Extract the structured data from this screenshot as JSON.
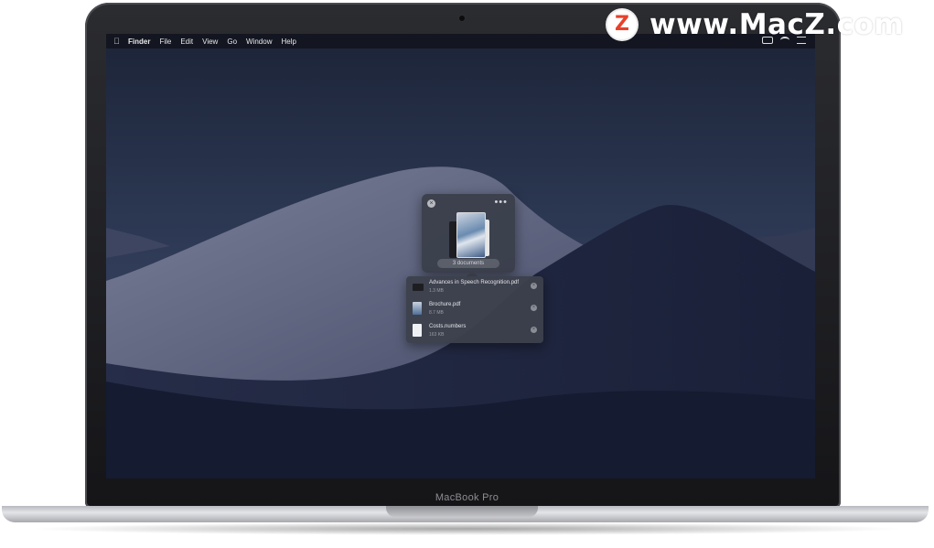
{
  "device": {
    "label": "MacBook Pro"
  },
  "menubar": {
    "apple_icon": "apple-icon",
    "items": [
      "Finder",
      "File",
      "Edit",
      "View",
      "Go",
      "Window",
      "Help"
    ]
  },
  "shelf": {
    "close_glyph": "×",
    "more_glyph": "•••",
    "summary": "3 documents"
  },
  "files": [
    {
      "name": "Advances in Speech Recognition.pdf",
      "size": "1.3 MB"
    },
    {
      "name": "Brochure.pdf",
      "size": "8.7 MB"
    },
    {
      "name": "Costs.numbers",
      "size": "163 KB"
    }
  ],
  "watermark": {
    "badge": "Z",
    "text": "www.MacZ.com"
  },
  "colors": {
    "watermark_badge": "#e8412b",
    "shelf_bg": "#3a3e4a"
  }
}
